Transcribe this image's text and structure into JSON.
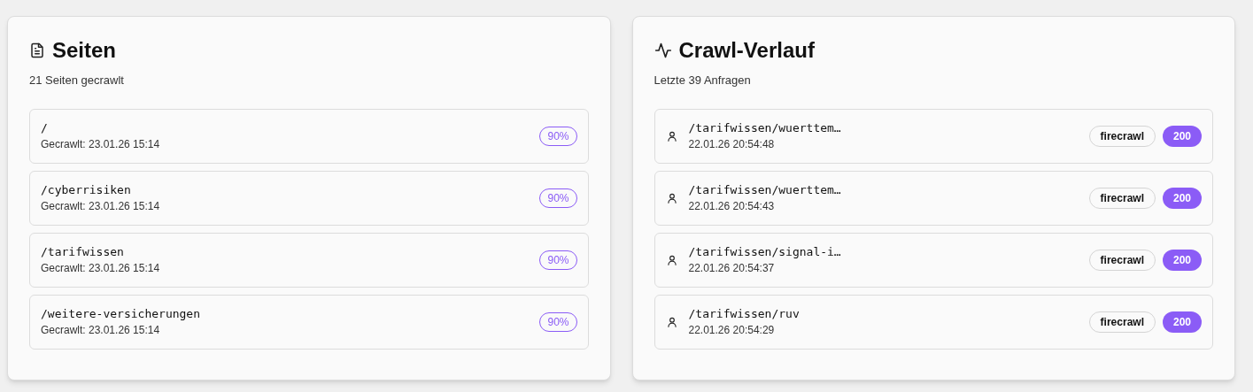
{
  "pages_panel": {
    "title": "Seiten",
    "subtitle": "21 Seiten gecrawlt",
    "items": [
      {
        "path": "/",
        "crawled": "Gecrawlt: 23.01.26 15:14",
        "score": "90%"
      },
      {
        "path": "/cyberrisiken",
        "crawled": "Gecrawlt: 23.01.26 15:14",
        "score": "90%"
      },
      {
        "path": "/tarifwissen",
        "crawled": "Gecrawlt: 23.01.26 15:14",
        "score": "90%"
      },
      {
        "path": "/weitere-versicherungen",
        "crawled": "Gecrawlt: 23.01.26 15:14",
        "score": "90%"
      }
    ]
  },
  "history_panel": {
    "title": "Crawl-Verlauf",
    "subtitle": "Letzte 39 Anfragen",
    "items": [
      {
        "path": "/tarifwissen/wuerttem…",
        "time": "22.01.26 20:54:48",
        "source": "firecrawl",
        "status": "200"
      },
      {
        "path": "/tarifwissen/wuerttem…",
        "time": "22.01.26 20:54:43",
        "source": "firecrawl",
        "status": "200"
      },
      {
        "path": "/tarifwissen/signal-i…",
        "time": "22.01.26 20:54:37",
        "source": "firecrawl",
        "status": "200"
      },
      {
        "path": "/tarifwissen/ruv",
        "time": "22.01.26 20:54:29",
        "source": "firecrawl",
        "status": "200"
      }
    ]
  }
}
